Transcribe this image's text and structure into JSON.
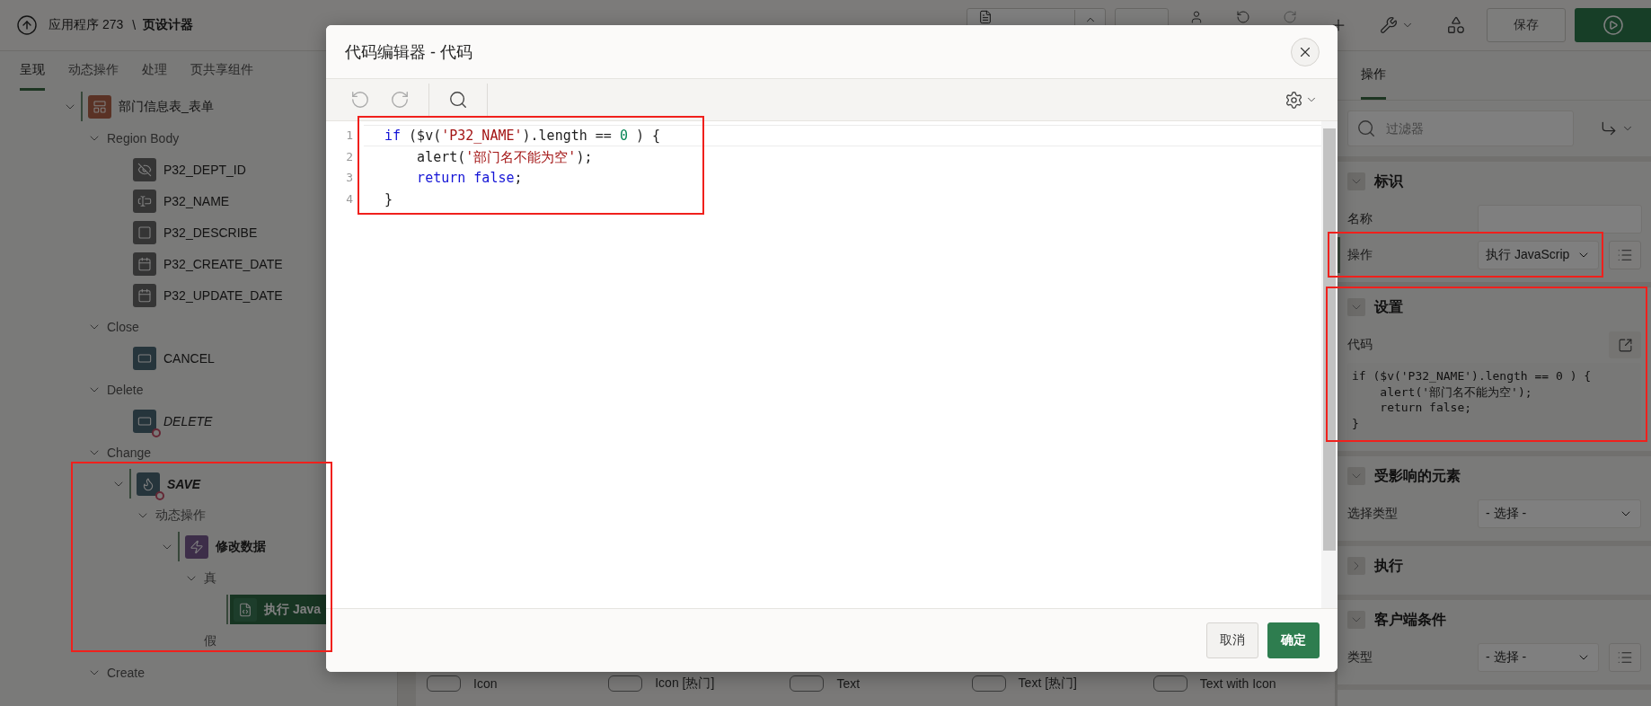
{
  "header": {
    "app": "应用程序 273",
    "separator": "\\",
    "page_title": "页设计器",
    "save": "保存"
  },
  "left_tabs": [
    {
      "label": "呈现",
      "selected": true
    },
    {
      "label": "动态操作",
      "selected": false
    },
    {
      "label": "处理",
      "selected": false
    },
    {
      "label": "页共享组件",
      "selected": false
    }
  ],
  "tree": [
    {
      "kind": "region",
      "label": "部门信息表_表单",
      "expanded": true,
      "selected": false,
      "bold": false,
      "italic": false,
      "badge": false,
      "children": [
        {
          "kind": "group",
          "label": "Region Body",
          "expanded": true,
          "selected": false,
          "children": [
            {
              "kind": "hidden-item",
              "label": "P32_DEPT_ID",
              "selected": false,
              "bold": false,
              "italic": false,
              "badge": false
            },
            {
              "kind": "text-item",
              "label": "P32_NAME",
              "selected": false,
              "bold": false,
              "italic": false,
              "badge": false
            },
            {
              "kind": "textarea-item",
              "label": "P32_DESCRIBE",
              "selected": false,
              "bold": false,
              "italic": false,
              "badge": false
            },
            {
              "kind": "date-item",
              "label": "P32_CREATE_DATE",
              "selected": false,
              "bold": false,
              "italic": false,
              "badge": false
            },
            {
              "kind": "date-item",
              "label": "P32_UPDATE_DATE",
              "selected": false,
              "bold": false,
              "italic": false,
              "badge": false
            }
          ]
        },
        {
          "kind": "group",
          "label": "Close",
          "expanded": true,
          "selected": false,
          "children": [
            {
              "kind": "button",
              "label": "CANCEL",
              "selected": false,
              "bold": false,
              "italic": false,
              "badge": false
            }
          ]
        },
        {
          "kind": "group",
          "label": "Delete",
          "expanded": true,
          "selected": false,
          "children": [
            {
              "kind": "button",
              "label": "DELETE",
              "selected": false,
              "bold": false,
              "italic": true,
              "badge": true
            }
          ]
        },
        {
          "kind": "group",
          "label": "Change",
          "expanded": true,
          "selected": false,
          "children": [
            {
              "kind": "dynamic-button",
              "label": "SAVE",
              "expanded": true,
              "selected": false,
              "bold": true,
              "italic": true,
              "badge": true,
              "children": [
                {
                  "kind": "group",
                  "label": "动态操作",
                  "expanded": true,
                  "selected": false,
                  "children": [
                    {
                      "kind": "event",
                      "label": "修改数据",
                      "expanded": true,
                      "selected": false,
                      "bold": true,
                      "italic": false,
                      "badge": false,
                      "children": [
                        {
                          "kind": "group",
                          "label": "真",
                          "expanded": true,
                          "selected": false,
                          "children": [
                            {
                              "kind": "action",
                              "label": "执行 Java",
                              "selected": true,
                              "bold": true,
                              "italic": false,
                              "badge": false
                            }
                          ]
                        },
                        {
                          "kind": "group",
                          "label": "假",
                          "selected": false
                        }
                      ]
                    }
                  ]
                }
              ]
            }
          ]
        },
        {
          "kind": "group",
          "label": "Create",
          "expanded": true,
          "selected": false
        }
      ]
    }
  ],
  "gallery": [
    {
      "label": "Icon"
    },
    {
      "label": "Icon [热门]"
    },
    {
      "label": "Text"
    },
    {
      "label": "Text [热门]"
    },
    {
      "label": "Text with Icon"
    }
  ],
  "right_tabs": [
    {
      "label": "操作",
      "selected": true
    }
  ],
  "filter": {
    "placeholder": "过滤器"
  },
  "sections": [
    {
      "title": "标识",
      "expanded": true,
      "fields": [
        {
          "kind": "text",
          "label": "名称",
          "highlighted": false
        },
        {
          "kind": "select",
          "label": "操作",
          "value": "执行 JavaScrip",
          "list_button": true,
          "highlighted": true
        }
      ]
    },
    {
      "title": "设置",
      "expanded": true,
      "fields": [
        {
          "kind": "code",
          "label": "代码",
          "value": "if ($v('P32_NAME').length == 0 ) {\n    alert('部门名不能为空');\n    return false;\n}",
          "highlighted": false
        }
      ]
    },
    {
      "title": "受影响的元素",
      "expanded": true,
      "fields": [
        {
          "kind": "select",
          "label": "选择类型",
          "value": "- 选择 -",
          "list_button": false,
          "highlighted": false
        }
      ]
    },
    {
      "title": "执行",
      "expanded": false
    },
    {
      "title": "客户端条件",
      "expanded": true,
      "fields": [
        {
          "kind": "select",
          "label": "类型",
          "value": "- 选择 -",
          "list_button": true,
          "highlighted": false
        }
      ]
    }
  ],
  "modal": {
    "title": "代码编辑器 - 代码",
    "code_lines": [
      {
        "number": "1",
        "active": true,
        "tokens": [
          {
            "kind": "keyword",
            "text": "if"
          },
          {
            "kind": "plain",
            "text": " ($v("
          },
          {
            "kind": "string",
            "text": "'P32_NAME'"
          },
          {
            "kind": "plain",
            "text": ").length == "
          },
          {
            "kind": "number",
            "text": "0"
          },
          {
            "kind": "plain",
            "text": " ) {"
          }
        ]
      },
      {
        "number": "2",
        "active": false,
        "tokens": [
          {
            "kind": "plain",
            "text": "    alert("
          },
          {
            "kind": "string",
            "text": "'部门名不能为空'"
          },
          {
            "kind": "plain",
            "text": ");"
          }
        ]
      },
      {
        "number": "3",
        "active": false,
        "tokens": [
          {
            "kind": "keyword",
            "text": "    return"
          },
          {
            "kind": "keyword",
            "text": " false"
          },
          {
            "kind": "plain",
            "text": ";"
          }
        ]
      },
      {
        "number": "4",
        "active": false,
        "tokens": [
          {
            "kind": "plain",
            "text": "}"
          }
        ]
      }
    ],
    "buttons": [
      {
        "kind": "secondary",
        "label": "取消"
      },
      {
        "kind": "primary",
        "label": "确定"
      }
    ]
  }
}
